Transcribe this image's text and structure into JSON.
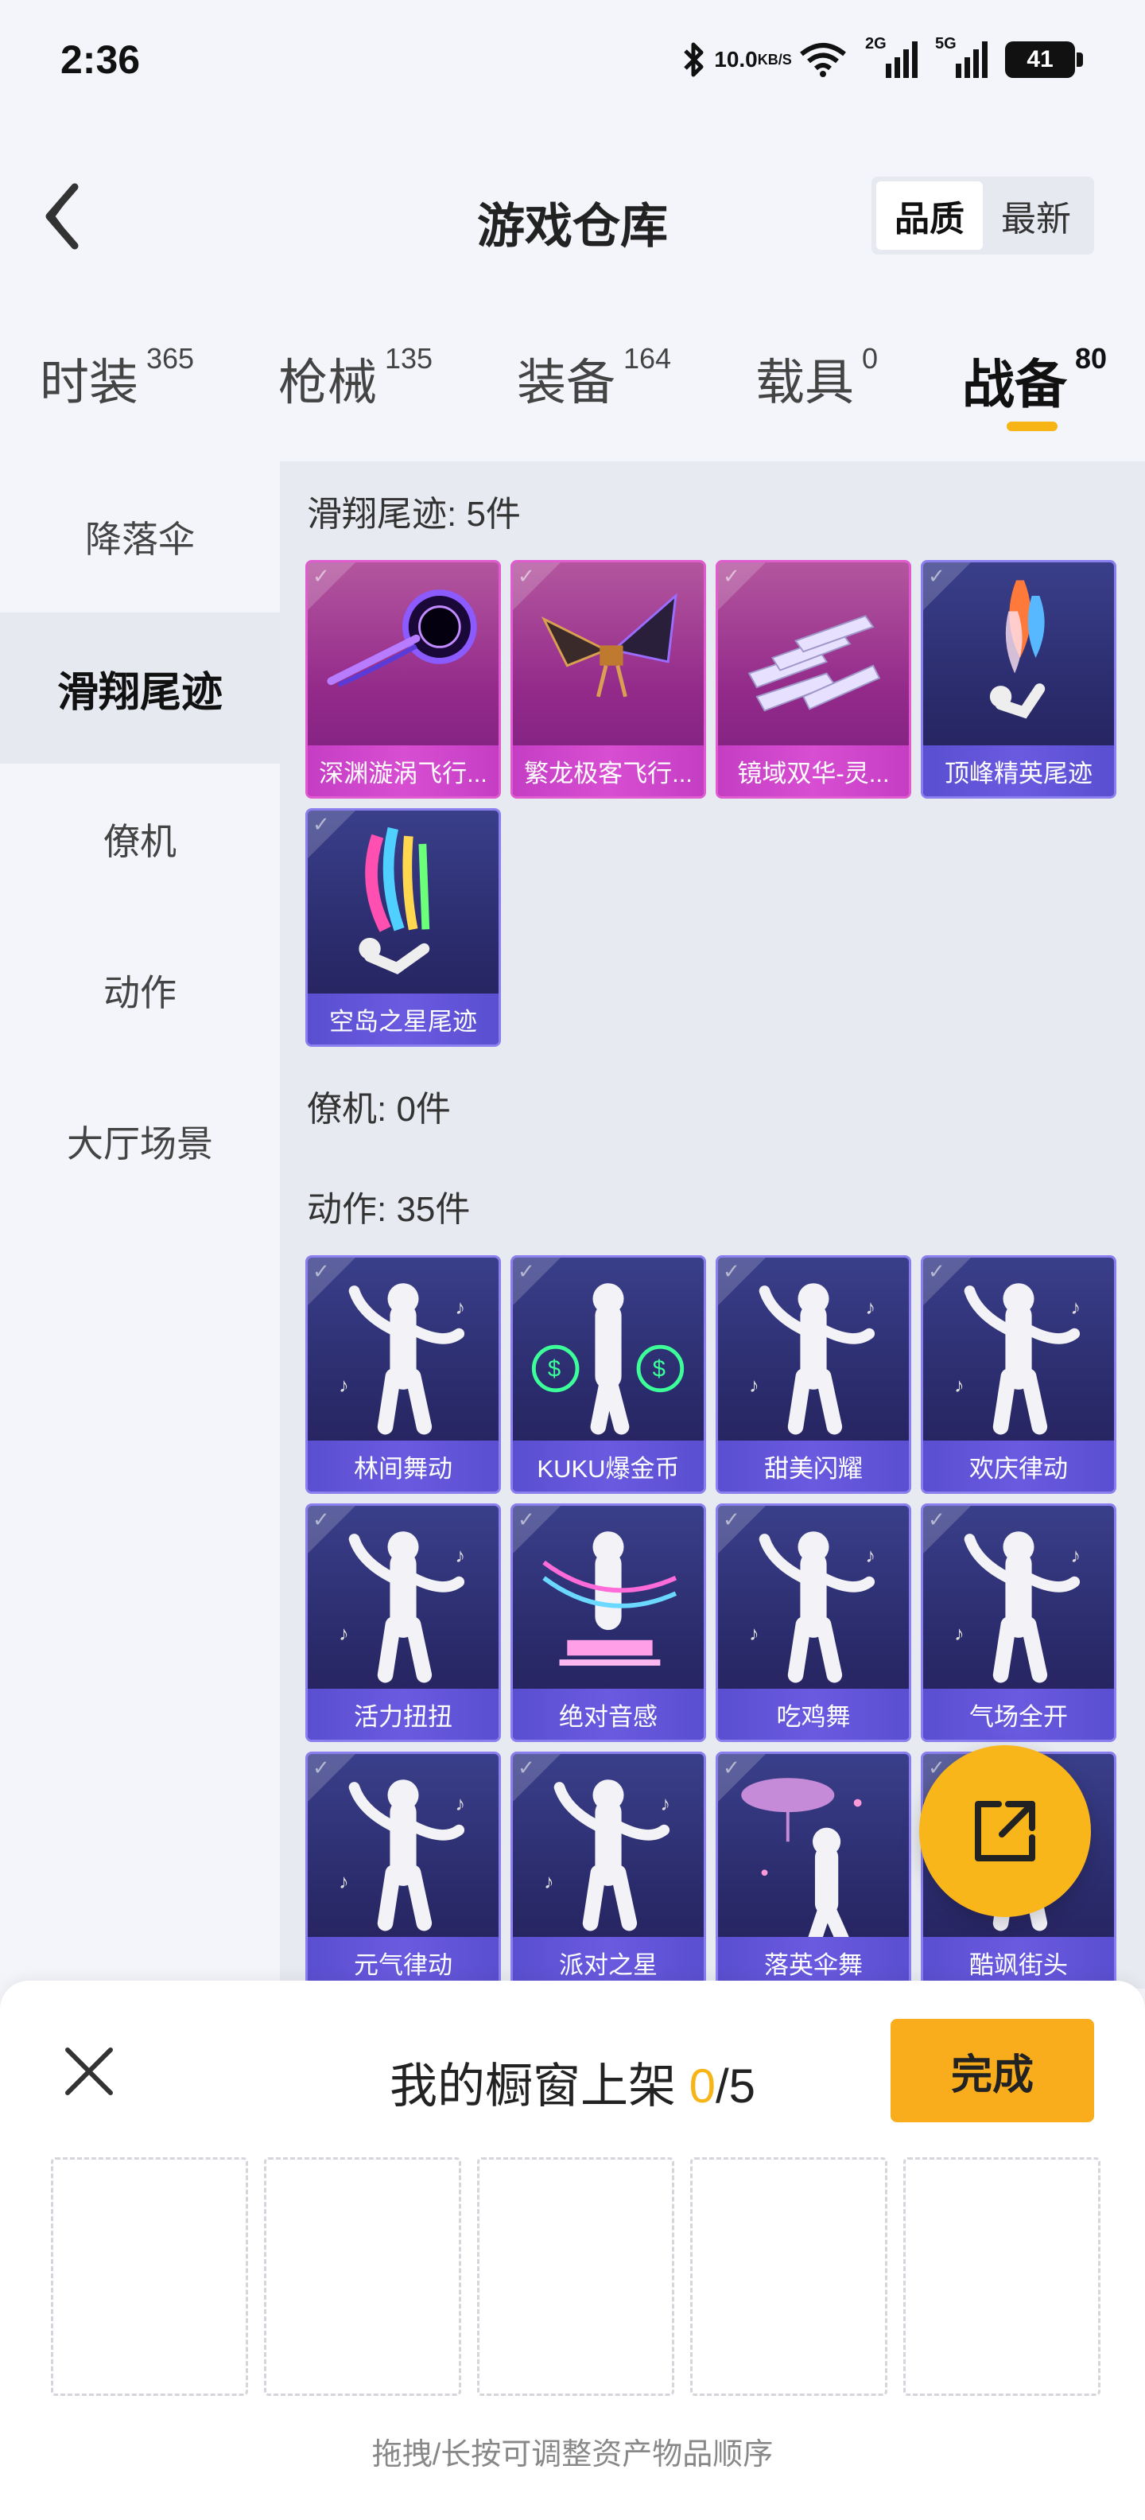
{
  "status_bar": {
    "time": "2:36",
    "net_speed_value": "10.0",
    "net_speed_unit": "KB/S",
    "signal_1_label": "2G",
    "signal_2_label": "5G",
    "battery": "41"
  },
  "header": {
    "title": "游戏仓库",
    "sort_options": [
      "品质",
      "最新"
    ],
    "sort_active": "品质"
  },
  "categories": [
    {
      "name": "时装",
      "count": "365"
    },
    {
      "name": "枪械",
      "count": "135"
    },
    {
      "name": "装备",
      "count": "164"
    },
    {
      "name": "载具",
      "count": "0"
    },
    {
      "name": "战备",
      "count": "80"
    }
  ],
  "active_category": "战备",
  "sidebar": {
    "items": [
      {
        "label": "降落伞"
      },
      {
        "label": "滑翔尾迹"
      },
      {
        "label": "僚机"
      },
      {
        "label": "动作"
      },
      {
        "label": "大厅场景"
      }
    ],
    "active": "滑翔尾迹"
  },
  "sections": [
    {
      "title": "滑翔尾迹: 5件",
      "items": [
        {
          "label": "深渊漩涡飞行...",
          "rarity": "pink",
          "icon": "vortex-trail-icon"
        },
        {
          "label": "繁龙极客飞行...",
          "rarity": "pink",
          "icon": "dragon-wing-icon"
        },
        {
          "label": "镜域双华-灵...",
          "rarity": "pink",
          "icon": "crystal-shards-icon"
        },
        {
          "label": "顶峰精英尾迹",
          "rarity": "purple",
          "icon": "flame-trail-icon"
        },
        {
          "label": "空岛之星尾迹",
          "rarity": "purple",
          "icon": "rainbow-trail-icon"
        }
      ]
    },
    {
      "title": "僚机: 0件",
      "items": []
    },
    {
      "title": "动作: 35件",
      "items": [
        {
          "label": "林间舞动",
          "rarity": "purple",
          "icon": "dance-pose-icon"
        },
        {
          "label": "KUKU爆金币",
          "rarity": "purple",
          "icon": "money-bag-icon"
        },
        {
          "label": "甜美闪耀",
          "rarity": "purple",
          "icon": "dance-pose-icon"
        },
        {
          "label": "欢庆律动",
          "rarity": "purple",
          "icon": "dance-pose-icon"
        },
        {
          "label": "活力扭扭",
          "rarity": "purple",
          "icon": "dance-pose-icon"
        },
        {
          "label": "绝对音感",
          "rarity": "purple",
          "icon": "piano-dance-icon"
        },
        {
          "label": "吃鸡舞",
          "rarity": "purple",
          "icon": "dance-pose-icon"
        },
        {
          "label": "气场全开",
          "rarity": "purple",
          "icon": "dance-pose-icon"
        },
        {
          "label": "元气律动",
          "rarity": "purple",
          "icon": "dance-pose-icon"
        },
        {
          "label": "派对之星",
          "rarity": "purple",
          "icon": "dance-pose-icon"
        },
        {
          "label": "落英伞舞",
          "rarity": "purple",
          "icon": "umbrella-dance-icon"
        },
        {
          "label": "酷飒街头",
          "rarity": "purple",
          "icon": "dance-pose-icon"
        }
      ]
    }
  ],
  "showcase": {
    "title_prefix": "我的橱窗上架 ",
    "current": "0",
    "separator_total": "/5",
    "done_label": "完成",
    "slots": 5,
    "hint": "拖拽/长按可调整资产物品顺序"
  },
  "colors": {
    "accent": "#f7b416",
    "rarity_pink": "#c43ec4",
    "rarity_purple": "#5a4fd0"
  }
}
